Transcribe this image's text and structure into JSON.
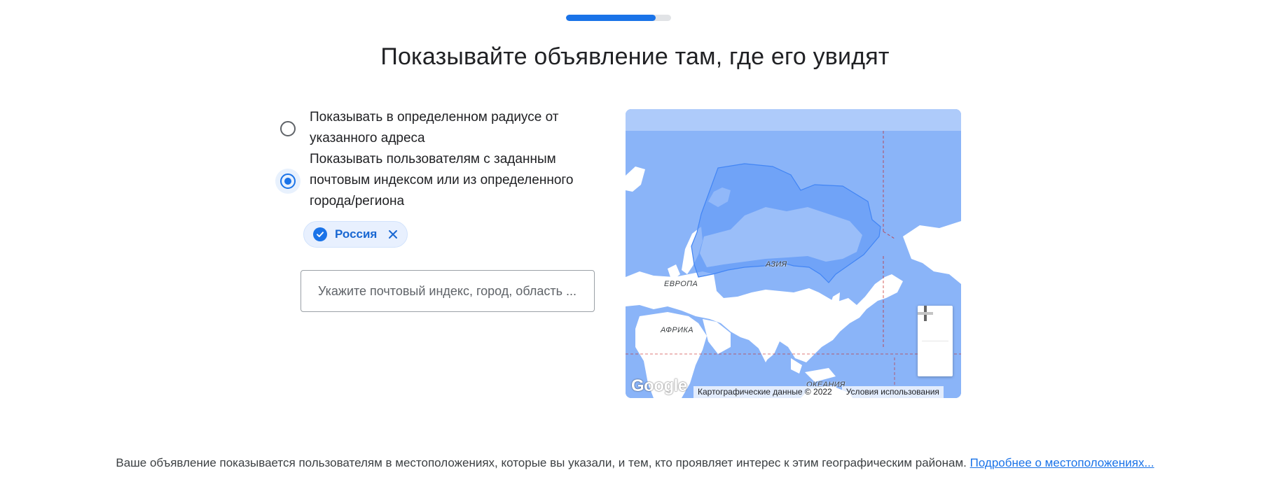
{
  "progress": {
    "fraction": 0.85
  },
  "page_title": "Показывайте объявление там, где его увидят",
  "targeting": {
    "options": [
      {
        "label": "Показывать в определенном радиусе от указанного адреса",
        "selected": false
      },
      {
        "label": "Показывать пользователям с заданным почтовым индексом или из определенного города/региона",
        "selected": true
      }
    ],
    "selected_location": {
      "label": "Россия"
    },
    "search": {
      "placeholder": "Укажите почтовый индекс, город, область ..."
    }
  },
  "map": {
    "labels": {
      "asia": "АЗИЯ",
      "europe": "ЕВРОПА",
      "africa": "АФРИКА",
      "ocean": "ОКЕАНИЯ"
    },
    "logo": "Google",
    "attribution": "Картографические данные © 2022",
    "terms": "Условия использования",
    "zoom_in": "+",
    "zoom_out": "−",
    "colors": {
      "water": "#8ab4f8",
      "land": "#ffffff",
      "highlight": "#669df6",
      "border": "#ea8600"
    }
  },
  "footer": {
    "text": "Ваше объявление показывается пользователям в местоположениях, которые вы указали, и тем, кто проявляет интерес к этим географическим районам.",
    "link": "Подробнее о местоположениях..."
  }
}
